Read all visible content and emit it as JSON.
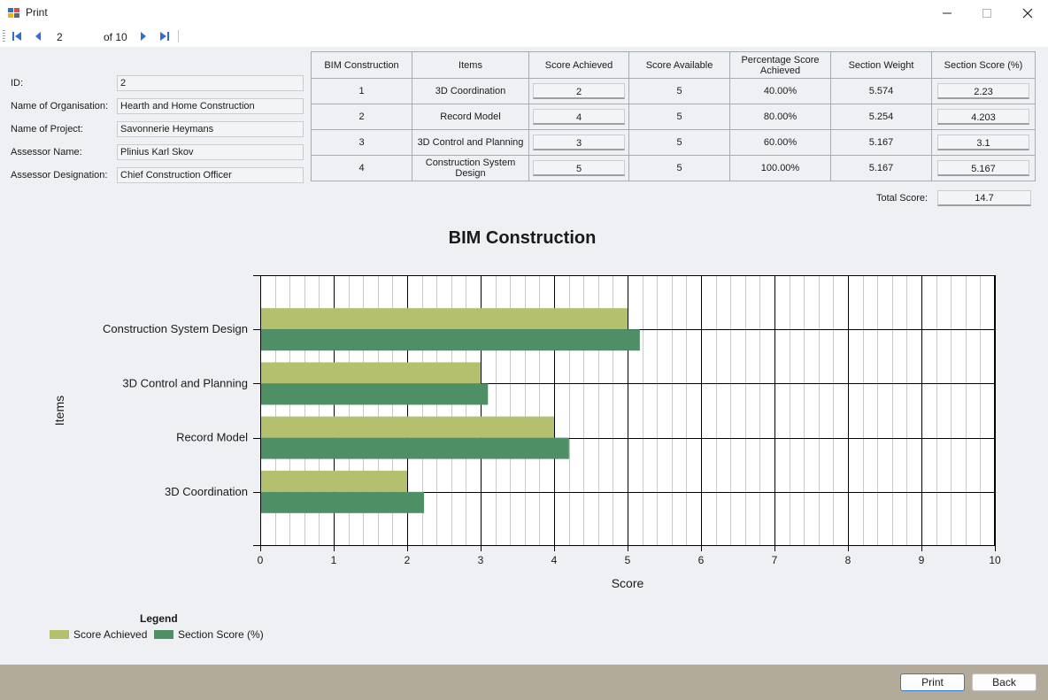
{
  "window": {
    "title": "Print"
  },
  "toolbar": {
    "page_value": "2",
    "of_label": "of 10"
  },
  "info": [
    {
      "label": "ID:",
      "value": "2"
    },
    {
      "label": "Name of Organisation:",
      "value": "Hearth and Home Construction"
    },
    {
      "label": "Name of Project:",
      "value": "Savonnerie Heymans"
    },
    {
      "label": "Assessor Name:",
      "value": "Plinius Karl Skov"
    },
    {
      "label": "Assessor Designation:",
      "value": "Chief Construction Officer"
    }
  ],
  "table": {
    "headers": [
      "BIM Construction",
      "Items",
      "Score Achieved",
      "Score Available",
      "Percentage Score Achieved",
      "Section Weight",
      "Section Score (%)"
    ],
    "rows": [
      [
        "1",
        "3D Coordination",
        "2",
        "5",
        "40.00%",
        "5.574",
        "2.23"
      ],
      [
        "2",
        "Record Model",
        "4",
        "5",
        "80.00%",
        "5.254",
        "4.203"
      ],
      [
        "3",
        "3D Control and Planning",
        "3",
        "5",
        "60.00%",
        "5.167",
        "3.1"
      ],
      [
        "4",
        "Construction System Design",
        "5",
        "5",
        "100.00%",
        "5.167",
        "5.167"
      ]
    ],
    "total_label": "Total Score:",
    "total_value": "14.7"
  },
  "chart_data": {
    "type": "bar",
    "orientation": "horizontal",
    "title": "BIM Construction",
    "xlabel": "Score",
    "ylabel": "Items",
    "categories": [
      "3D Coordination",
      "Record Model",
      "3D Control and Planning",
      "Construction System Design"
    ],
    "series": [
      {
        "name": "Score Achieved",
        "values": [
          2,
          4,
          3,
          5
        ],
        "color": "#b5c06e"
      },
      {
        "name": "Section Score (%)",
        "values": [
          2.23,
          4.203,
          3.1,
          5.167
        ],
        "color": "#4f8f66"
      }
    ],
    "xlim": [
      0,
      10
    ],
    "x_ticks": [
      "0",
      "1",
      "2",
      "3",
      "4",
      "5",
      "6",
      "7",
      "8",
      "9",
      "10"
    ],
    "grid": true,
    "legend": {
      "title": "Legend",
      "placement": "bottom-left"
    }
  },
  "footer": {
    "print_label": "Print",
    "back_label": "Back"
  }
}
